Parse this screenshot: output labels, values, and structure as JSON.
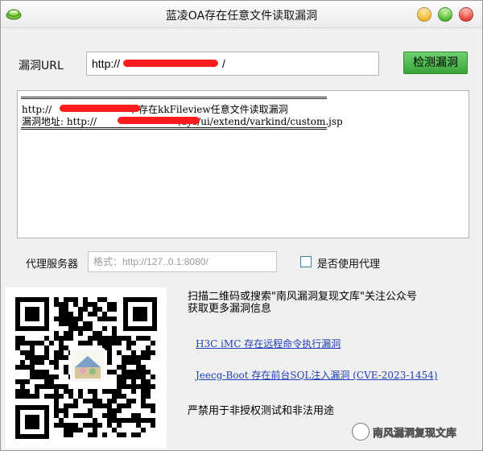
{
  "window": {
    "title": "蓝凌OA存在任意文件读取漏洞"
  },
  "url_row": {
    "label": "漏洞URL",
    "value_prefix": "http://",
    "value_suffix": "/",
    "detect_button": "检测漏洞"
  },
  "output": {
    "line1_prefix": "http://",
    "line1_suffix": "/  存在kkFileview任意文件读取漏洞",
    "line2_prefix": "漏洞地址: http://",
    "line2_suffix": "/sys/ui/extend/varkind/custom.jsp"
  },
  "proxy": {
    "label": "代理服务器",
    "placeholder": "格式：http://127..0.1:8080/",
    "checkbox_label": "是否使用代理",
    "checked": false
  },
  "promo": {
    "line1": "扫描二维码或搜索\"南风漏洞复现文库\"关注公众号",
    "line2": "获取更多漏洞信息"
  },
  "links": [
    "H3C iMC 存在远程命令执行漏洞",
    "Jeecg-Boot 存在前台SQL注入漏洞 (CVE-2023-1454)"
  ],
  "warning": "严禁用于非授权测试和非法用途",
  "watermark": "南风漏洞复现文库",
  "colors": {
    "redaction": "#ff1d1d",
    "button_green": "#3aa53a",
    "link_blue": "#1f3fb6"
  },
  "icons": {
    "app": "app-logo-icon",
    "minimize": "minimize-icon",
    "maximize": "maximize-icon",
    "close": "close-icon"
  }
}
